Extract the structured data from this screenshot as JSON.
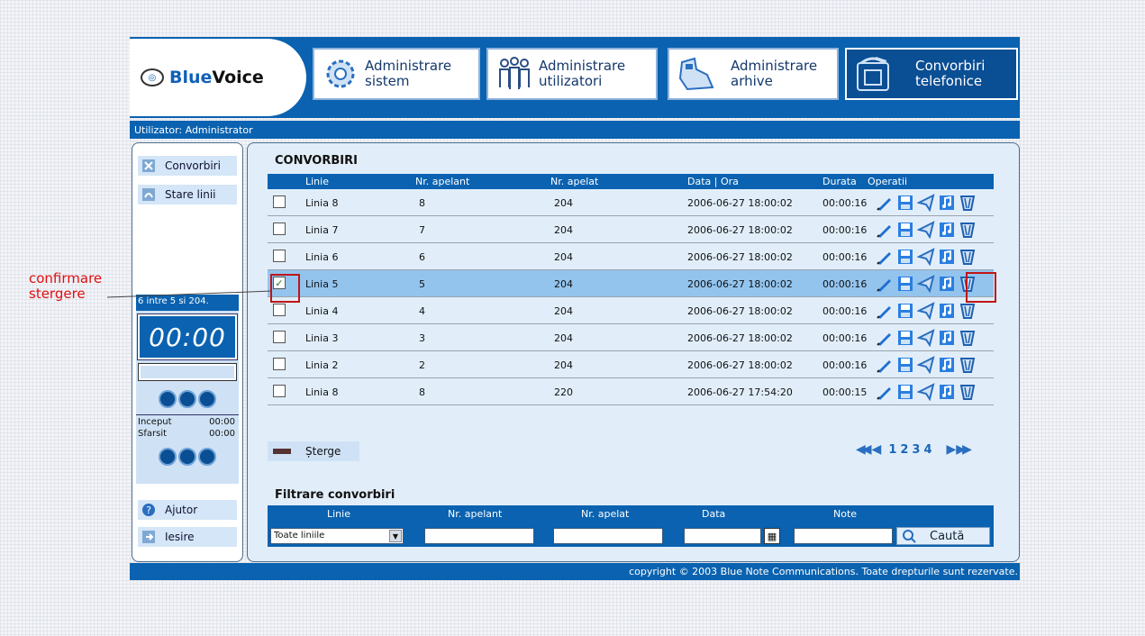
{
  "brand": {
    "name_part1": "Blue",
    "name_part2": "Voice"
  },
  "nav": [
    {
      "line1": "Administrare",
      "line2": "sistem",
      "icon": "gear-icon",
      "active": false
    },
    {
      "line1": "Administrare",
      "line2": "utilizatori",
      "icon": "users-icon",
      "active": false
    },
    {
      "line1": "Administrare",
      "line2": "arhive",
      "icon": "archive-icon",
      "active": false
    },
    {
      "line1": "Convorbiri",
      "line2": "telefonice",
      "icon": "phone-icon",
      "active": true
    }
  ],
  "user_bar": "Utilizator: Administrator",
  "sidebar": {
    "items": [
      {
        "label": "Convorbiri",
        "icon": "calls-icon"
      },
      {
        "label": "Stare linii",
        "icon": "lines-status-icon"
      }
    ],
    "bottom_items": [
      {
        "label": "Ajutor",
        "icon": "help-icon"
      },
      {
        "label": "Iesire",
        "icon": "exit-icon"
      }
    ]
  },
  "player": {
    "title": "6 intre 5 si 204.",
    "time": "00:00",
    "start_label": "Inceput",
    "start_value": "00:00",
    "end_label": "Sfarsit",
    "end_value": "00:00"
  },
  "calls": {
    "title": "CONVORBIRI",
    "columns": [
      "Linie",
      "Nr. apelant",
      "Nr. apelat",
      "Data | Ora",
      "Durata",
      "Operatii"
    ],
    "rows": [
      {
        "line": "Linia 8",
        "caller": "8",
        "called": "204",
        "datetime": "2006-06-27 18:00:02",
        "duration": "00:00:16",
        "checked": false
      },
      {
        "line": "Linia 7",
        "caller": "7",
        "called": "204",
        "datetime": "2006-06-27 18:00:02",
        "duration": "00:00:16",
        "checked": false
      },
      {
        "line": "Linia 6",
        "caller": "6",
        "called": "204",
        "datetime": "2006-06-27 18:00:02",
        "duration": "00:00:16",
        "checked": false
      },
      {
        "line": "Linia 5",
        "caller": "5",
        "called": "204",
        "datetime": "2006-06-27 18:00:02",
        "duration": "00:00:16",
        "checked": true
      },
      {
        "line": "Linia 4",
        "caller": "4",
        "called": "204",
        "datetime": "2006-06-27 18:00:02",
        "duration": "00:00:16",
        "checked": false
      },
      {
        "line": "Linia 3",
        "caller": "3",
        "called": "204",
        "datetime": "2006-06-27 18:00:02",
        "duration": "00:00:16",
        "checked": false
      },
      {
        "line": "Linia 2",
        "caller": "2",
        "called": "204",
        "datetime": "2006-06-27 18:00:02",
        "duration": "00:00:16",
        "checked": false
      },
      {
        "line": "Linia 8",
        "caller": "8",
        "called": "220",
        "datetime": "2006-06-27 17:54:20",
        "duration": "00:00:15",
        "checked": false
      }
    ],
    "operations": [
      "edit-icon",
      "save-icon",
      "send-icon",
      "play-icon",
      "delete-icon"
    ]
  },
  "delete_label": "Șterge",
  "pagination": {
    "pages": [
      "1",
      "2",
      "3",
      "4"
    ]
  },
  "filter": {
    "title": "Filtrare convorbiri",
    "labels": {
      "line": "Linie",
      "caller": "Nr. apelant",
      "called": "Nr. apelat",
      "date": "Data",
      "notes": "Note"
    },
    "line_selected": "Toate liniile",
    "caller_value": "",
    "called_value": "",
    "date_value": "",
    "notes_value": "",
    "search_label": "Caută"
  },
  "footer": "copyright © 2003 Blue Note Communications. Toate drepturile sunt rezervate.",
  "annotation": {
    "line1": "confirmare",
    "line2": "stergere"
  },
  "colors": {
    "primary": "#0a62b0",
    "panel": "#e1eefa",
    "selected_row": "#93c4ee",
    "highlight": "#c01515"
  }
}
